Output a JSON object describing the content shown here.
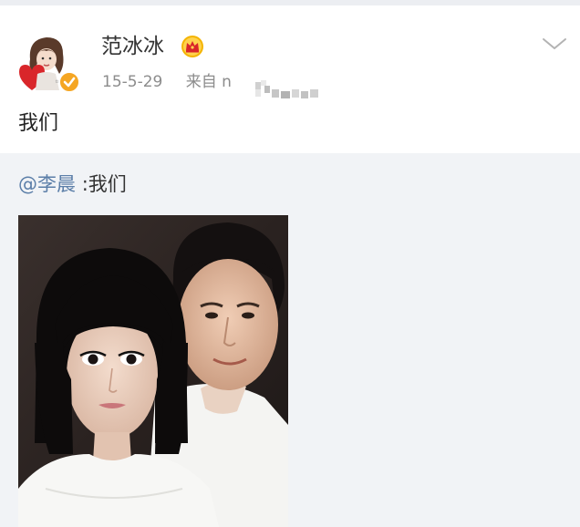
{
  "post": {
    "username": "范冰冰",
    "date": "15-5-29",
    "source_label": "来自 n",
    "text": "我们"
  },
  "repost": {
    "mention": "@李晨",
    "separator": ":",
    "text": "我们"
  },
  "icons": {
    "verified": "verified-icon",
    "crown": "crown-icon",
    "more": "chevron-down-icon"
  },
  "colors": {
    "username": "#333333",
    "meta": "#8c8c8c",
    "mention": "#5b7ea8",
    "verified": "#f5a623",
    "repost_background": "#f1f3f6"
  }
}
